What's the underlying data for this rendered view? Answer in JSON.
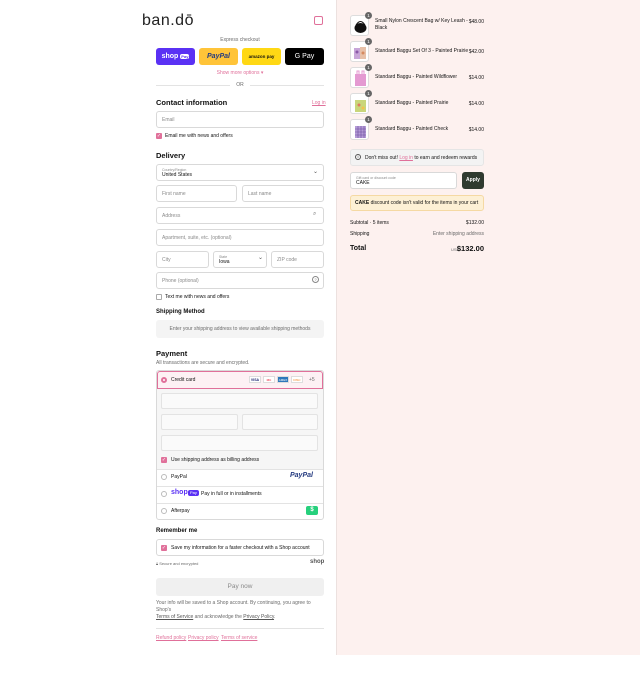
{
  "brand": "ban.dō",
  "express": {
    "label": "Express checkout",
    "shop_pay": "shop",
    "shop_pay_badge": "Pay",
    "paypal": "PayPal",
    "amazon": "amazon pay",
    "gpay": "G Pay",
    "more": "Show more options ▾",
    "or": "OR"
  },
  "contact": {
    "title": "Contact information",
    "login": "Log in",
    "email_placeholder": "Email",
    "news_label": "Email me with news and offers"
  },
  "delivery": {
    "title": "Delivery",
    "country_label": "Country/Region",
    "country_value": "United States",
    "first_name": "First name",
    "last_name": "Last name",
    "address": "Address",
    "apartment": "Apartment, suite, etc. (optional)",
    "city": "City",
    "state_label": "State",
    "state_value": "Iowa",
    "zip": "ZIP code",
    "phone": "Phone (optional)",
    "text_label": "Text me with news and offers"
  },
  "shipping": {
    "title": "Shipping Method",
    "message": "Enter your shipping address to view available shipping methods"
  },
  "payment": {
    "title": "Payment",
    "subtitle": "All transactions are secure and encrypted.",
    "credit_card": "Credit card",
    "cards": [
      "VISA",
      "MC",
      "AMEX",
      "DISC"
    ],
    "more_cards": "+5",
    "billing_same": "Use shipping address as billing address",
    "paypal": "PayPal",
    "paypal_logo": "PayPal",
    "shop_pay_logo": "shop",
    "shop_pay_badge": "Pay",
    "shop_pay_text": "Pay in full or in installments",
    "afterpay": "Afterpay",
    "afterpay_logo": "$"
  },
  "remember": {
    "title": "Remember me",
    "label": "Save my information for a faster checkout with a Shop account",
    "secure": "Secure and encrypted",
    "shop": "shop"
  },
  "pay_now": "Pay now",
  "legal": {
    "line1": "Your info will be saved to a Shop account. By continuing, you agree to Shop's",
    "tos": "Terms of Service",
    "and": "and acknowledge the",
    "privacy": "Privacy Policy",
    "period": "."
  },
  "footer": {
    "refund": "Refund policy",
    "privacy": "Privacy policy",
    "terms": "Terms of service"
  },
  "cart": {
    "items": [
      {
        "name": "Small Nylon Crescent Bag w/ Key Leash - Black",
        "price": "$48.00",
        "qty": "1"
      },
      {
        "name": "Standard Baggu Set Of 3 - Painted Prairie",
        "price": "$42.00",
        "qty": "1"
      },
      {
        "name": "Standard Baggu - Painted Wildflower",
        "price": "$14.00",
        "qty": "1"
      },
      {
        "name": "Standard Baggu - Painted Prairie",
        "price": "$14.00",
        "qty": "1"
      },
      {
        "name": "Standard Baggu - Painted Check",
        "price": "$14.00",
        "qty": "1"
      }
    ],
    "rewards_pre": "Don't miss out!",
    "rewards_link": "Log in",
    "rewards_post": "to earn and redeem rewards",
    "discount_label": "Gift card or discount code",
    "discount_value": "CAKE",
    "apply": "Apply",
    "error_code": "CAKE",
    "error_text": "discount code isn't valid for the items in your cart",
    "subtotal_label": "Subtotal · 5 items",
    "subtotal_value": "$132.00",
    "shipping_label": "Shipping",
    "shipping_value": "Enter shipping address",
    "total_label": "Total",
    "currency": "USD",
    "total_value": "$132.00"
  },
  "colors": {
    "accent": "#e0709a",
    "shop_pay": "#5a31f4",
    "paypal_yellow": "#ffc439",
    "sidebar_bg": "#fdf1ef"
  }
}
